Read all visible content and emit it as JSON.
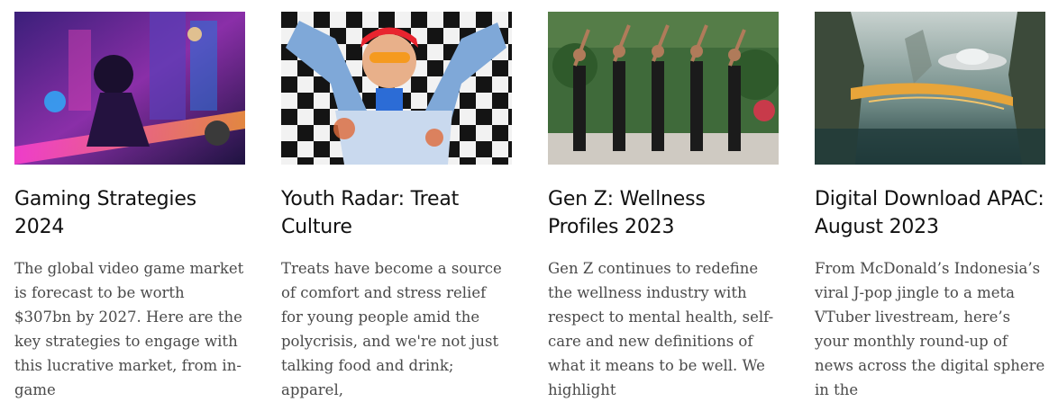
{
  "cards": [
    {
      "title": "Gaming Strategies 2024",
      "description": "The global video game market is forecast to be worth $307bn by 2027. Here are the key strategies to engage with this lucrative market, from in-game",
      "image_icon": "gaming-hero-image"
    },
    {
      "title": "Youth Radar: Treat Culture",
      "description": "Treats have become a source of comfort and stress relief for young people amid the polycrisis, and we're not just talking food and drink; apparel,",
      "image_icon": "treat-culture-portrait-image"
    },
    {
      "title": "Gen Z: Wellness Profiles 2023",
      "description": "Gen Z continues to redefine the wellness industry with respect to mental health, self-care and new definitions of what it means to be well. We highlight",
      "image_icon": "wellness-group-image"
    },
    {
      "title": "Digital Download APAC: August 2023",
      "description": "From McDonald’s Indonesia’s viral J-pop jingle to a meta VTuber livestream, here’s your monthly round-up of news across the digital sphere in the",
      "image_icon": "futuristic-landscape-image"
    }
  ]
}
